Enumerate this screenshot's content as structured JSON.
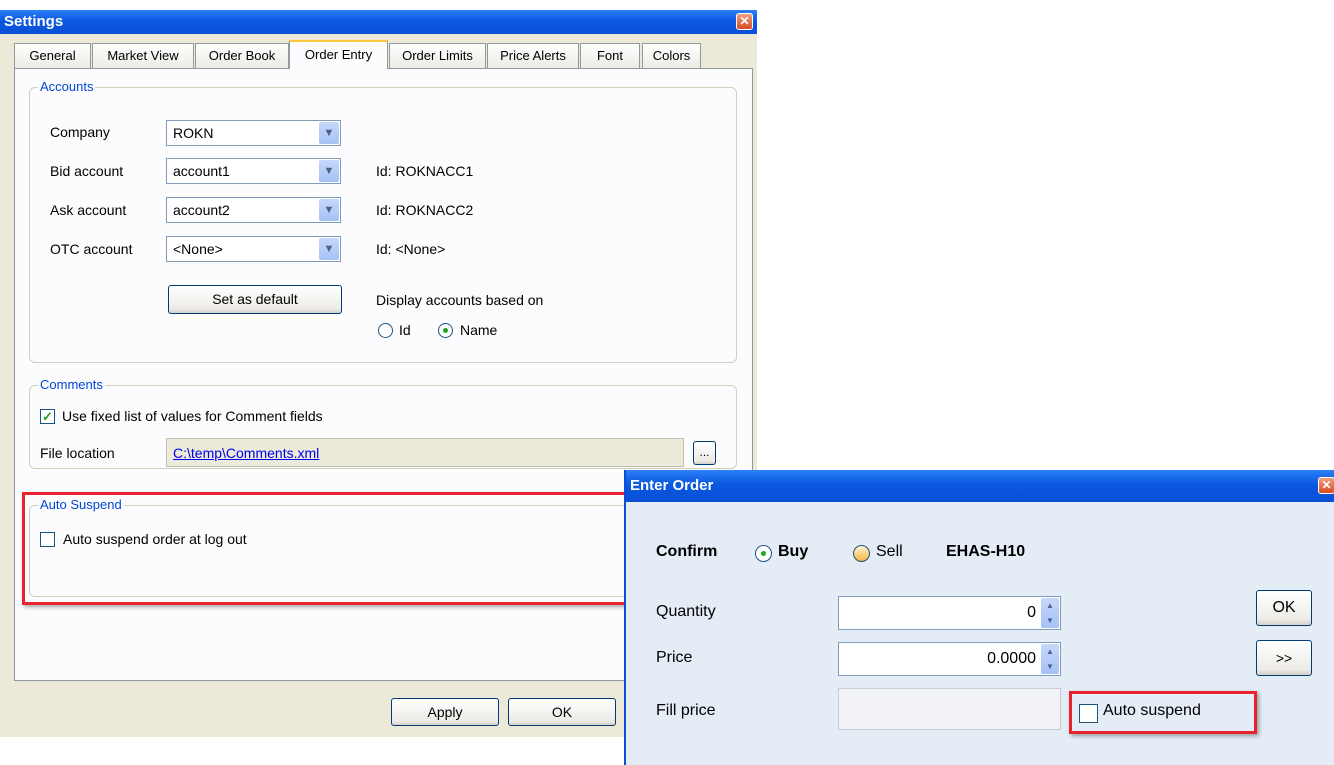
{
  "settings": {
    "title": "Settings",
    "tabs": [
      {
        "label": "General"
      },
      {
        "label": "Market View"
      },
      {
        "label": "Order Book"
      },
      {
        "label": "Order Entry"
      },
      {
        "label": "Order Limits"
      },
      {
        "label": "Price Alerts"
      },
      {
        "label": "Font"
      },
      {
        "label": "Colors"
      }
    ],
    "accounts": {
      "legend": "Accounts",
      "company_label": "Company",
      "company_value": "ROKN",
      "bid_label": "Bid account",
      "bid_value": "account1",
      "bid_id": "Id: ROKNACC1",
      "ask_label": "Ask account",
      "ask_value": "account2",
      "ask_id": "Id: ROKNACC2",
      "otc_label": "OTC account",
      "otc_value": "<None>",
      "otc_id": "Id: <None>",
      "set_default_label": "Set as default",
      "display_based_label": "Display accounts based on",
      "radio_id_label": "Id",
      "radio_name_label": "Name"
    },
    "comments": {
      "legend": "Comments",
      "fixed_list_label": "Use fixed list of values for Comment fields",
      "file_location_label": "File location",
      "file_location_value": "C:\\temp\\Comments.xml",
      "browse_label": "..."
    },
    "auto_suspend": {
      "legend": "Auto Suspend",
      "checkbox_label": "Auto suspend order at log out"
    },
    "apply_label": "Apply",
    "ok_label": "OK"
  },
  "enter_order": {
    "title": "Enter Order",
    "confirm_label": "Confirm",
    "buy_label": "Buy",
    "sell_label": "Sell",
    "instrument": "EHAS-H10",
    "quantity_label": "Quantity",
    "quantity_value": "0",
    "price_label": "Price",
    "price_value": "0.0000",
    "fill_price_label": "Fill price",
    "auto_suspend_label": "Auto suspend",
    "ok_label": "OK",
    "more_label": ">>"
  },
  "colors": {
    "title_blue": "#0a58e0",
    "highlight_red": "#e8232e",
    "legend_blue": "#0046d5"
  }
}
